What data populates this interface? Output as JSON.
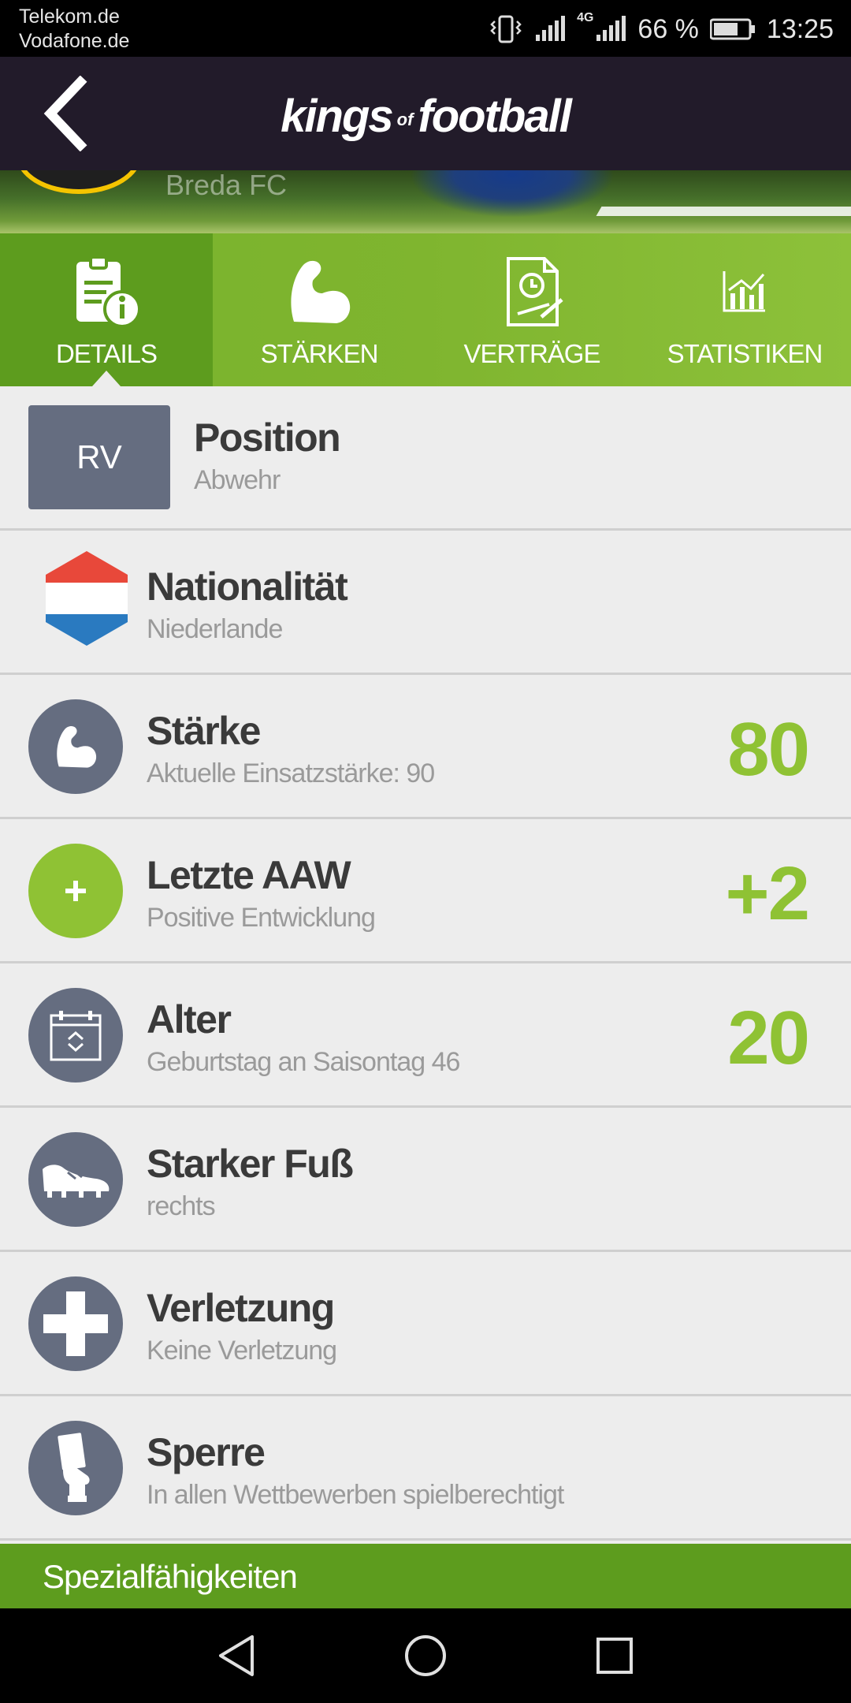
{
  "status_bar": {
    "carrier_1": "Telekom.de",
    "carrier_2": "Vodafone.de",
    "network": "4G",
    "battery": "66 %",
    "time": "13:25"
  },
  "app_bar": {
    "logo_part1": "kings",
    "logo_part2": "of",
    "logo_part3": "football"
  },
  "hero": {
    "club": "Breda FC"
  },
  "tabs": [
    {
      "label": "DETAILS",
      "icon": "document-info-icon",
      "active": true
    },
    {
      "label": "STÄRKEN",
      "icon": "flexed-arm-icon",
      "active": false
    },
    {
      "label": "VERTRÄGE",
      "icon": "contract-clock-icon",
      "active": false
    },
    {
      "label": "STATISTIKEN",
      "icon": "bar-chart-icon",
      "active": false
    }
  ],
  "details": {
    "position": {
      "code": "RV",
      "title": "Position",
      "subtitle": "Abwehr"
    },
    "nationality": {
      "title": "Nationalität",
      "subtitle": "Niederlande",
      "icon": "netherlands-flag-icon"
    },
    "strength": {
      "title": "Stärke",
      "subtitle": "Aktuelle Einsatzstärke: 90",
      "value": "80",
      "icon": "flexed-arm-icon"
    },
    "last_aaw": {
      "title": "Letzte AAW",
      "subtitle": "Positive Entwicklung",
      "value": "+2",
      "icon": "plus-icon"
    },
    "age": {
      "title": "Alter",
      "subtitle": "Geburtstag an Saisontag 46",
      "value": "20",
      "icon": "calendar-icon"
    },
    "strong_foot": {
      "title": "Starker Fuß",
      "subtitle": "rechts",
      "icon": "football-boot-icon"
    },
    "injury": {
      "title": "Verletzung",
      "subtitle": "Keine Verletzung",
      "icon": "medical-cross-icon"
    },
    "suspension": {
      "title": "Sperre",
      "subtitle": "In allen Wettbewerben spielberechtigt",
      "icon": "referee-card-icon"
    }
  },
  "special_abilities": {
    "label": "Spezialfähigkeiten"
  },
  "colors": {
    "green": "#5d9c1e",
    "value_green": "#8fc234",
    "dark": "#221b2a",
    "icon_grey": "#656d80"
  }
}
